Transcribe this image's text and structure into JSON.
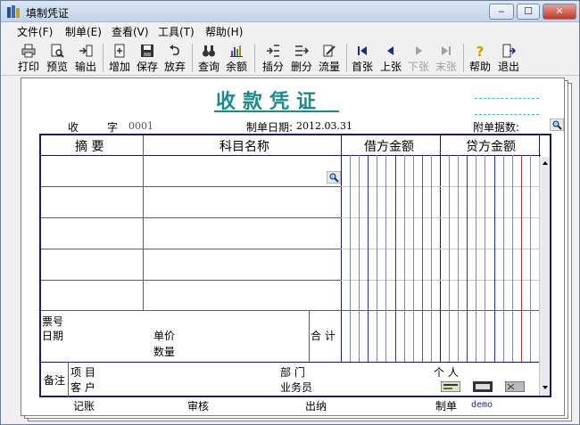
{
  "window": {
    "title": "填制凭证",
    "minimize": "‒",
    "maximize": "☐",
    "close": "✕"
  },
  "menu": [
    {
      "label": "文件(F)"
    },
    {
      "label": "制单(E)"
    },
    {
      "label": "查看(V)"
    },
    {
      "label": "工具(T)"
    },
    {
      "label": "帮助(H)"
    }
  ],
  "toolbar": {
    "print": "打印",
    "preview": "预览",
    "export": "输出",
    "add": "增加",
    "save": "保存",
    "discard": "放弃",
    "query": "查询",
    "balance": "余额",
    "insert": "插分",
    "delete": "删分",
    "flow": "流量",
    "first": "首张",
    "prev": "上张",
    "next": "下张",
    "last": "末张",
    "help": "帮助",
    "exit": "退出"
  },
  "voucher": {
    "title": "收款凭证",
    "type_label": "收",
    "word_label": "字",
    "number": "0001",
    "date_label": "制单日期:",
    "date": "2012.03.31",
    "attachments_label": "附单据数:",
    "columns": {
      "summary": "摘 要",
      "account": "科目名称",
      "debit": "借方金额",
      "credit": "贷方金额"
    },
    "labels": {
      "ticket_no": "票号",
      "date": "日期",
      "unit_price": "单价",
      "quantity": "数量",
      "total": "合 计",
      "remark": "备注",
      "project": "项 目",
      "customer": "客 户",
      "department": "部 门",
      "salesperson": "业务员",
      "person": "个 人"
    },
    "footer": {
      "posted": "记账",
      "audit": "审核",
      "cashier": "出纳",
      "maker": "制单",
      "maker_name": "demo"
    }
  },
  "colors": {
    "title_teal": "#1a8a8a",
    "grid_border": "#1a1a6a",
    "amount_blue": "#2030c0",
    "amount_red": "#c03030"
  }
}
